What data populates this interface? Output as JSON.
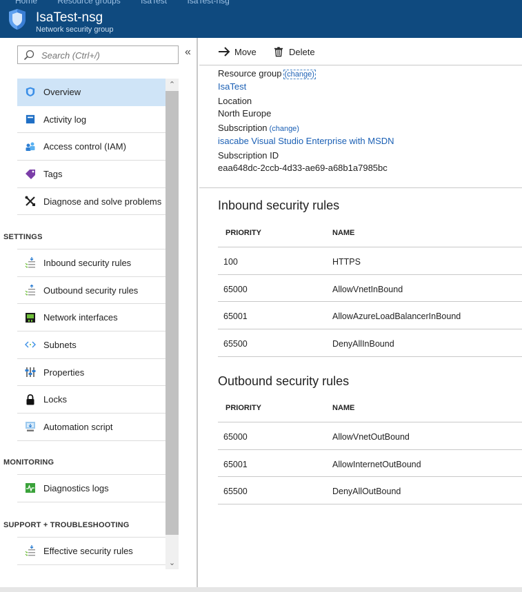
{
  "header": {
    "breadcrumbs": [
      "Home",
      "Resource groups",
      "IsaTest",
      "IsaTest-nsg"
    ],
    "title": "IsaTest-nsg",
    "subtitle": "Network security group",
    "icon": "nsg-shield-icon",
    "color": "#0f4a7f"
  },
  "search": {
    "placeholder": "Search (Ctrl+/)",
    "collapse_label": "«"
  },
  "nav": {
    "items": [
      {
        "label": "Overview",
        "icon": "shield-icon"
      },
      {
        "label": "Activity log",
        "icon": "activity-log-icon"
      },
      {
        "label": "Access control (IAM)",
        "icon": "iam-users-icon"
      },
      {
        "label": "Tags",
        "icon": "tag-icon"
      },
      {
        "label": "Diagnose and solve problems",
        "icon": "wrench-icon"
      },
      {
        "label": "Inbound security rules",
        "icon": "inbound-rules-icon"
      },
      {
        "label": "Outbound security rules",
        "icon": "outbound-rules-icon"
      },
      {
        "label": "Network interfaces",
        "icon": "network-interface-icon"
      },
      {
        "label": "Subnets",
        "icon": "subnet-icon"
      },
      {
        "label": "Properties",
        "icon": "properties-icon"
      },
      {
        "label": "Locks",
        "icon": "lock-icon"
      },
      {
        "label": "Automation script",
        "icon": "automation-script-icon"
      },
      {
        "label": "Diagnostics logs",
        "icon": "diagnostics-icon"
      },
      {
        "label": "Effective security rules",
        "icon": "effective-rules-icon"
      }
    ],
    "sections": {
      "settings": "SETTINGS",
      "monitoring": "MONITORING",
      "support": "SUPPORT + TROUBLESHOOTING"
    },
    "active": "Overview"
  },
  "toolbar": {
    "move_label": "Move",
    "delete_label": "Delete"
  },
  "essentials": {
    "resource_group_label": "Resource group",
    "resource_group_change": "(change)",
    "resource_group_value": "IsaTest",
    "location_label": "Location",
    "location_value": "North Europe",
    "subscription_label": "Subscription",
    "subscription_change": "(change)",
    "subscription_value": "isacabe Visual Studio Enterprise with MSDN",
    "subscription_id_label": "Subscription ID",
    "subscription_id_value": "eaa648dc-2ccb-4d33-ae69-a68b1a7985bc"
  },
  "inbound": {
    "title": "Inbound security rules",
    "headers": [
      "PRIORITY",
      "NAME"
    ],
    "rows": [
      {
        "priority": "100",
        "name": "HTTPS"
      },
      {
        "priority": "65000",
        "name": "AllowVnetInBound"
      },
      {
        "priority": "65001",
        "name": "AllowAzureLoadBalancerInBound"
      },
      {
        "priority": "65500",
        "name": "DenyAllInBound"
      }
    ]
  },
  "outbound": {
    "title": "Outbound security rules",
    "headers": [
      "PRIORITY",
      "NAME"
    ],
    "rows": [
      {
        "priority": "65000",
        "name": "AllowVnetOutBound"
      },
      {
        "priority": "65001",
        "name": "AllowInternetOutBound"
      },
      {
        "priority": "65500",
        "name": "DenyAllOutBound"
      }
    ]
  },
  "colors": {
    "accent": "#1a5fb4",
    "active_nav": "#cfe4f7"
  }
}
